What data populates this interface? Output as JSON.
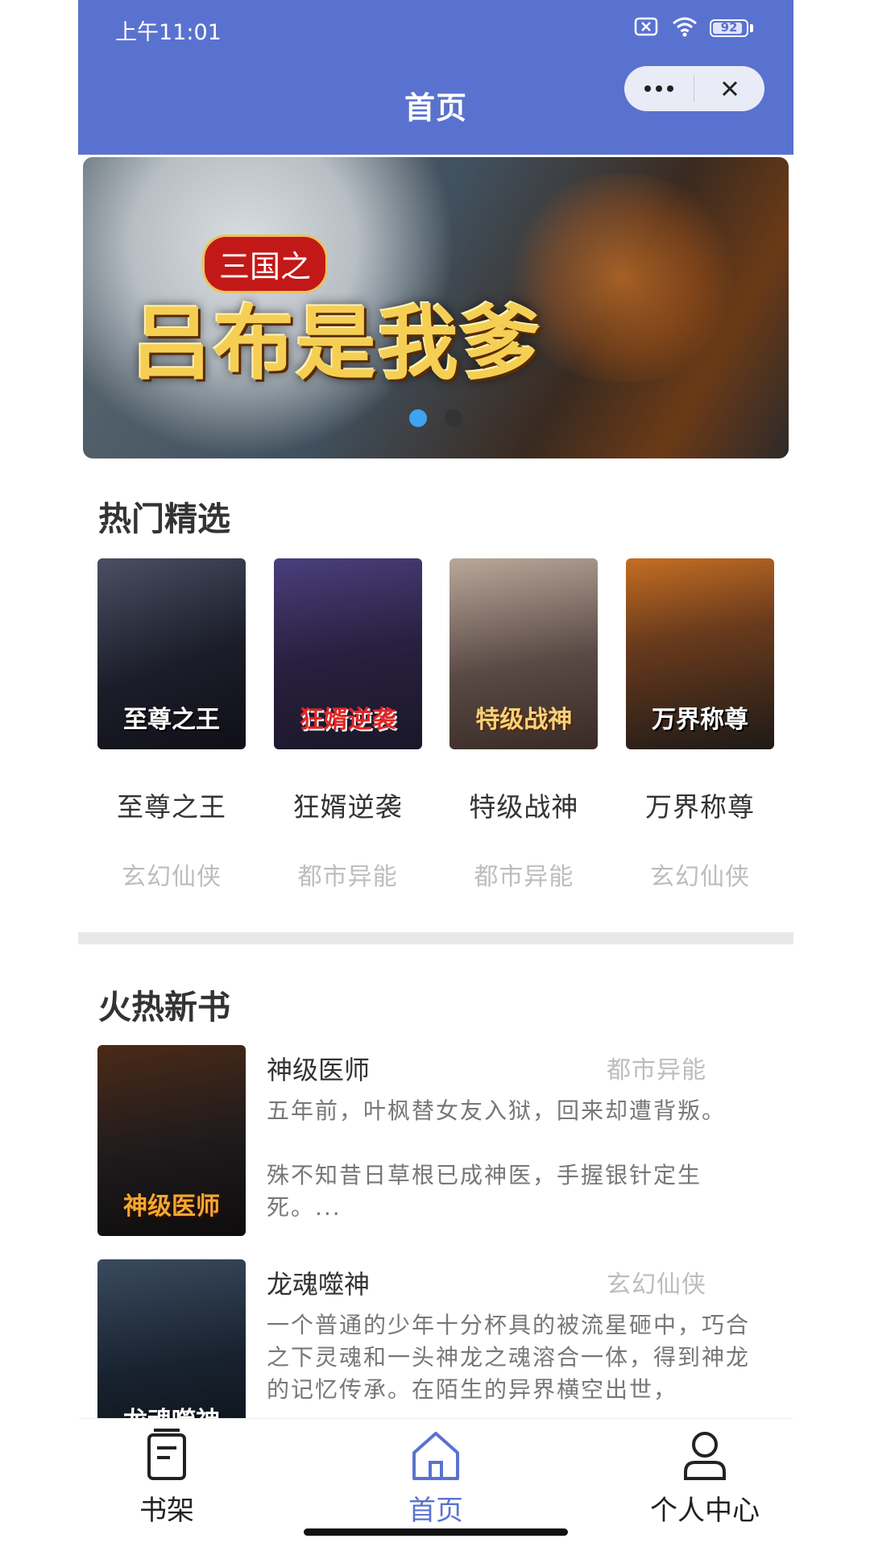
{
  "status_bar": {
    "time": "上午11:01",
    "battery": "92",
    "battery_level": 0.92
  },
  "nav": {
    "title": "首页"
  },
  "banner": {
    "subtitle": "三国之",
    "title": "吕布是我爹",
    "slide_count": 2,
    "active_slide": 0
  },
  "hot": {
    "title": "热门精选",
    "books": [
      {
        "name": "至尊之王",
        "category": "玄幻仙侠",
        "cover_text": "至尊之王"
      },
      {
        "name": "狂婿逆袭",
        "category": "都市异能",
        "cover_text": "狂婿逆袭"
      },
      {
        "name": "特级战神",
        "category": "都市异能",
        "cover_text": "特级战神"
      },
      {
        "name": "万界称尊",
        "category": "玄幻仙侠",
        "cover_text": "万界称尊"
      }
    ]
  },
  "new_books": {
    "title": "火热新书",
    "items": [
      {
        "name": "神级医师",
        "category": "都市异能",
        "cover_text": "神级医师",
        "desc1": "五年前，叶枫替女友入狱，回来却遭背叛。",
        "desc2": "殊不知昔日草根已成神医，手握银针定生死。..."
      },
      {
        "name": "龙魂噬神",
        "category": "玄幻仙侠",
        "cover_text": "龙魂噬神",
        "desc1": "一个普通的少年十分杯具的被流星砸中，巧合之下灵魂和一头神龙之魂溶合一体，得到神龙的记忆传承。在陌生的异界横空出世，",
        "desc2": ""
      }
    ]
  },
  "tabbar": {
    "items": [
      {
        "label": "书架",
        "icon": "bookshelf-icon"
      },
      {
        "label": "首页",
        "icon": "home-icon"
      },
      {
        "label": "个人中心",
        "icon": "user-icon"
      }
    ],
    "active_color": "#5a72cf"
  },
  "colors": {
    "primary": "#5a72cf",
    "dot_active": "#3fa3f0"
  }
}
